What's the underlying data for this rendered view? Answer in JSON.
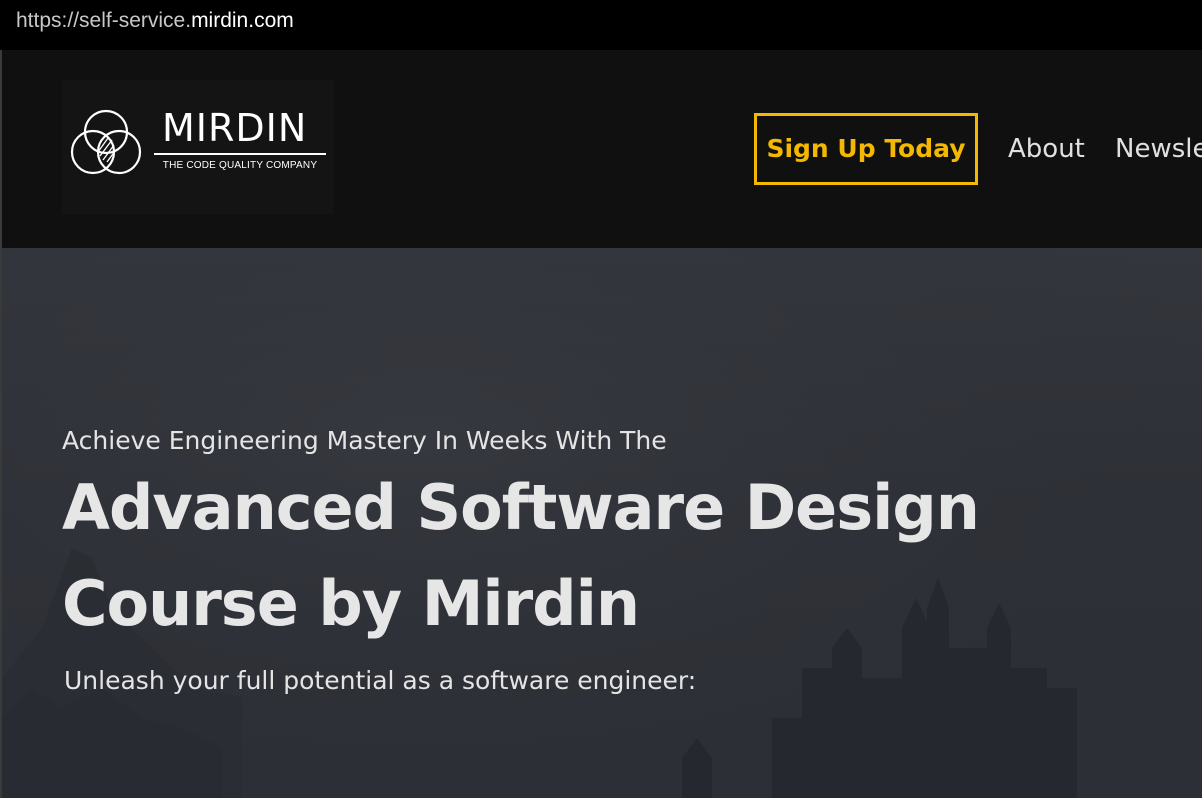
{
  "browser": {
    "url_prefix": "https://self-service.",
    "url_domain": "mirdin.com"
  },
  "header": {
    "logo": {
      "name": "MIRDIN",
      "tagline": "THE CODE QUALITY COMPANY"
    },
    "cta_label": "Sign Up Today",
    "nav": [
      {
        "label": "About"
      },
      {
        "label": "Newsle"
      }
    ]
  },
  "hero": {
    "eyebrow": "Achieve Engineering Mastery In Weeks With The",
    "title": "Advanced Software Design Course by Mirdin",
    "subtitle": "Unleash your full potential as a software engineer:"
  },
  "colors": {
    "accent": "#f5b800",
    "header_bg": "#101010",
    "hero_bg": "#2e3035"
  },
  "icons": {
    "logo_mark": "overlapping-circles-icon"
  }
}
